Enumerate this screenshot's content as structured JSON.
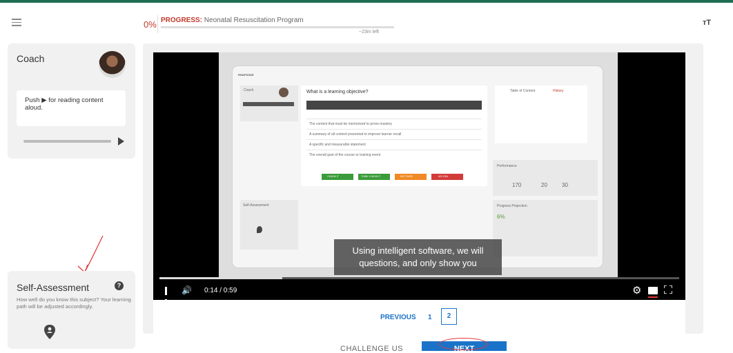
{
  "header": {
    "progress_percent": "0%",
    "progress_label": "PROGRESS:",
    "program_name": "Neonatal Resuscitation Program",
    "progress_fraction": 0.0,
    "time_left": "~23m left",
    "font_toggle": "тТ"
  },
  "coach": {
    "title": "Coach",
    "message_before": "Push",
    "message_after": "for reading content aloud."
  },
  "self_assessment": {
    "title": "Self-Assessment",
    "description": "How well do you know this subject? Your learning path will be adjusted accordingly."
  },
  "video": {
    "caption_line1": "Using intelligent software, we will",
    "caption_line2": "questions, and only show you",
    "time": "0:14 / 0:59",
    "played_fraction": 0.237,
    "embedded": {
      "brand": "RHAPSODE",
      "coach": "Coach",
      "question": "What is a learning objective?",
      "answers": [
        "The content that must be memorized to prove mastery",
        "A summary of all content presented to improve learner recall",
        "A specific and measurable statement",
        "The overall goal of the course or training event"
      ],
      "buttons": [
        "I KNOW IT",
        "THINK I KNOW IT",
        "NOT SURE",
        "NO IDEA"
      ],
      "button_colors": [
        "#3a9b3a",
        "#3a9b3a",
        "#f08a24",
        "#d33a3a"
      ],
      "toc_tabs": [
        "Table of Content",
        "History"
      ],
      "performance_title": "Performance",
      "performance_values": [
        "170",
        "20",
        "30"
      ],
      "projection_title": "Progress Projection",
      "projection_value": "6%",
      "sa_title": "Self-Assessment"
    }
  },
  "pager": {
    "previous": "PREVIOUS",
    "pages": [
      "1",
      "2"
    ],
    "current_page": "2"
  },
  "footer": {
    "challenge": "CHALLENGE US",
    "next": "NEXT"
  },
  "colors": {
    "accent": "#1a73c9",
    "progress_red": "#c0392b",
    "topline": "#1e6e55",
    "annotation": "#e23a3a"
  }
}
